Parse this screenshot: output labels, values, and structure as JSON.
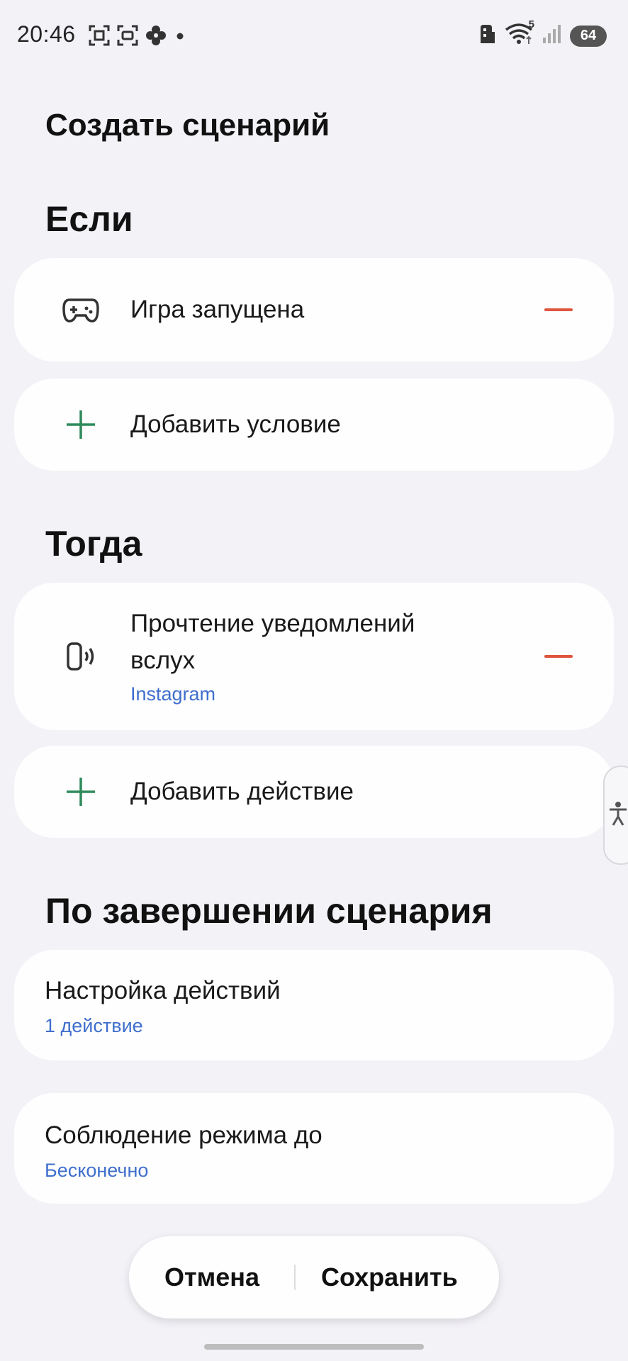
{
  "status_bar": {
    "time": "20:46",
    "battery": "64",
    "signal_label": "5",
    "left_icons": [
      "screenshot-icon",
      "screen-record-icon",
      "flower-icon",
      "dot-icon"
    ],
    "right_icons": [
      "building-icon",
      "wifi-icon",
      "cellular-signal-icon",
      "battery-icon"
    ]
  },
  "page": {
    "title": "Создать сценарий"
  },
  "if_section": {
    "title": "Если",
    "condition": {
      "label": "Игра запущена",
      "icon": "gamepad-icon"
    },
    "add_label": "Добавить условие"
  },
  "then_section": {
    "title": "Тогда",
    "action": {
      "label_line1": "Прочтение уведомлений",
      "label_line2": "вслух",
      "sub": "Instagram",
      "icon": "phone-speaker-icon"
    },
    "add_label": "Добавить действие"
  },
  "end_section": {
    "title": "По завершении сценария",
    "settings": {
      "label": "Настройка действий",
      "sub": "1 действие"
    },
    "duration": {
      "label": "Соблюдение режима до",
      "sub": "Бесконечно"
    }
  },
  "bottom_bar": {
    "cancel_label": "Отмена",
    "save_label": "Сохранить"
  },
  "colors": {
    "background": "#f3f2f7",
    "card": "#fefeff",
    "accent_blue": "#3f6fcc",
    "remove_red": "#e0553d",
    "add_green": "#2e8a5a"
  }
}
